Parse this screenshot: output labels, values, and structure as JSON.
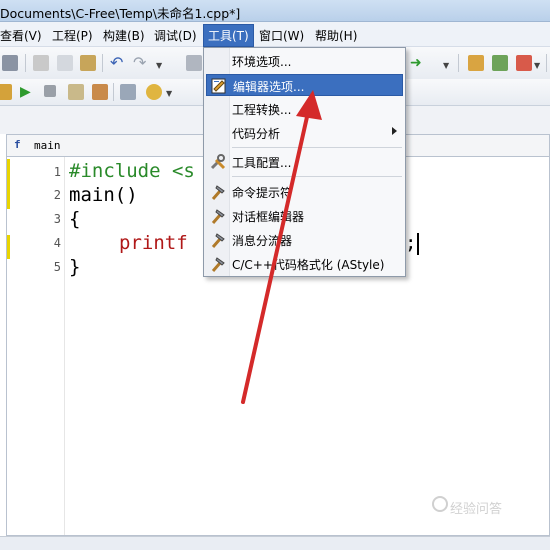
{
  "window": {
    "title": "Documents\\C-Free\\Temp\\未命名1.cpp*]"
  },
  "menubar": {
    "items": [
      {
        "label": "查看(V)"
      },
      {
        "label": "工程(P)"
      },
      {
        "label": "构建(B)"
      },
      {
        "label": "调试(D)"
      },
      {
        "label": "工具(T)"
      },
      {
        "label": "窗口(W)"
      },
      {
        "label": "帮助(H)"
      }
    ]
  },
  "tools_menu": {
    "items": [
      {
        "label": "环境选项...",
        "icon": "blank"
      },
      {
        "label": "编辑器选项...",
        "icon": "editor-options-icon",
        "highlighted": true
      },
      {
        "label": "工程转换...",
        "icon": "blank"
      },
      {
        "label": "代码分析",
        "icon": "blank",
        "submenu": true
      },
      {
        "label": "工具配置...",
        "icon": "tools-icon"
      },
      {
        "label": "命令提示符",
        "icon": "hammer-icon"
      },
      {
        "label": "对话框编辑器",
        "icon": "hammer-icon"
      },
      {
        "label": "消息分流器",
        "icon": "hammer-icon"
      },
      {
        "label": "C/C++代码格式化 (AStyle)",
        "icon": "hammer-icon"
      }
    ]
  },
  "editor": {
    "tab": {
      "icon": "function-icon",
      "label": "main"
    },
    "lines": [
      {
        "no": "1",
        "text": "#include <s"
      },
      {
        "no": "2",
        "text": "main()"
      },
      {
        "no": "3",
        "text": "{"
      },
      {
        "no": "4",
        "text": "printf",
        "tail": ";"
      },
      {
        "no": "5",
        "text": "}"
      }
    ]
  },
  "watermark": {
    "text": "经验问答"
  },
  "colors": {
    "menu_highlight": "#3b6fbf",
    "annotation_arrow": "#d42a2a",
    "preprocessor": "#2a8a2a",
    "function": "#b01818"
  }
}
